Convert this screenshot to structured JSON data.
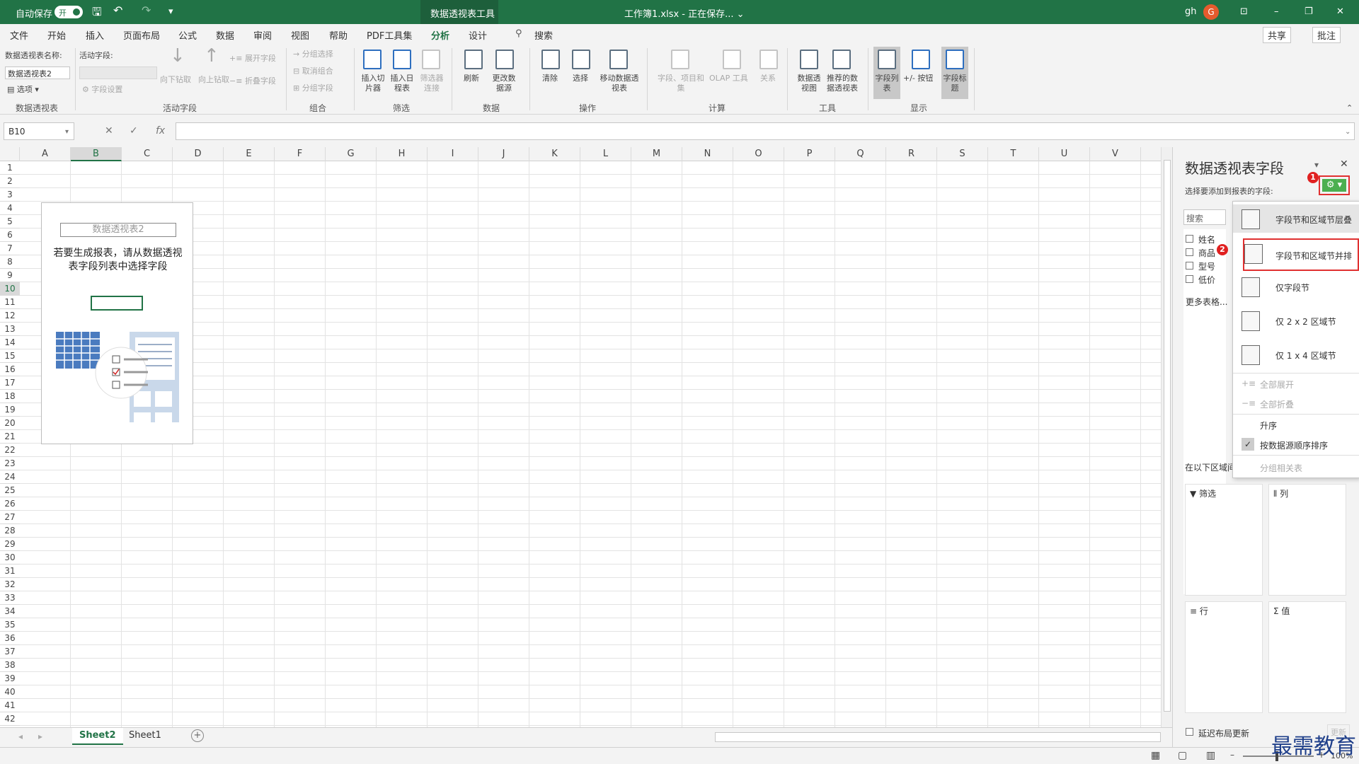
{
  "title_bar": {
    "autosave_label": "自动保存",
    "autosave_state": "开",
    "context_tool": "数据透视表工具",
    "file_title": "工作簿1.xlsx - 正在保存... ⌄",
    "user": "gh",
    "avatar": "G",
    "minimize": "–",
    "restore": "❐",
    "close": "✕"
  },
  "tabs": [
    "文件",
    "开始",
    "插入",
    "页面布局",
    "公式",
    "数据",
    "审阅",
    "视图",
    "帮助",
    "PDF工具集",
    "分析",
    "设计"
  ],
  "active_tab": "分析",
  "search_label": "搜索",
  "share_label": "共享",
  "comment_label": "批注",
  "ribbon": {
    "pt_name_label": "数据透视表名称:",
    "pt_name_value": "数据透视表2",
    "options_label": "选项",
    "group_pivot": "数据透视表",
    "active_field_label": "活动字段:",
    "field_settings": "字段设置",
    "drill_down": "向下钻取",
    "drill_up": "向上钻取",
    "expand_field": "展开字段",
    "collapse_field": "折叠字段",
    "group_active_field": "活动字段",
    "group_selection": "分组选择",
    "ungroup": "取消组合",
    "group_field": "分组字段",
    "group_group": "组合",
    "insert_slicer": "插入切片器",
    "insert_timeline": "插入日程表",
    "filter_connections": "筛选器连接",
    "group_filter": "筛选",
    "refresh": "刷新",
    "change_source": "更改数据源",
    "group_data": "数据",
    "clear": "清除",
    "select": "选择",
    "move_pivot": "移动数据透视表",
    "group_actions": "操作",
    "fields_items": "字段、项目和集",
    "olap_tools": "OLAP 工具",
    "relationships": "关系",
    "group_calc": "计算",
    "pivot_chart": "数据透视图",
    "recommended": "推荐的数据透视表",
    "group_tools": "工具",
    "field_list": "字段列表",
    "buttons": "+/- 按钮",
    "field_headers": "字段标题",
    "group_show": "显示"
  },
  "formula_bar": {
    "name_box": "B10",
    "cancel": "✕",
    "enter": "✓",
    "fx": "fx",
    "formula": ""
  },
  "columns": [
    "A",
    "B",
    "C",
    "D",
    "E",
    "F",
    "G",
    "H",
    "I",
    "J",
    "K",
    "L",
    "M",
    "N",
    "O",
    "P",
    "Q",
    "R",
    "S",
    "T",
    "U",
    "V"
  ],
  "selected_column": "B",
  "selected_row": 10,
  "row_count": 42,
  "pivot_placeholder": {
    "title": "数据透视表2",
    "line1": "若要生成报表，请从数据透视",
    "line2": "表字段列表中选择字段"
  },
  "sheet_tabs": [
    "Sheet2",
    "Sheet1"
  ],
  "active_sheet": "Sheet2",
  "add_sheet": "+",
  "status": {
    "zoom": "100%"
  },
  "panel": {
    "title": "数据透视表字段",
    "subtitle": "选择要添加到报表的字段:",
    "search_placeholder": "搜索",
    "fields": [
      "姓名",
      "商品",
      "型号",
      "低价"
    ],
    "more_tables": "更多表格...",
    "areas_label": "在以下区域间",
    "filter_label": "筛选",
    "columns_label": "列",
    "rows_label": "行",
    "values_label": "值",
    "defer_label": "延迟布局更新",
    "update_label": "更新",
    "badge1": "1",
    "badge2": "2"
  },
  "menu": {
    "stacked": "字段节和区域节层叠",
    "side_by_side": "字段节和区域节并排",
    "fields_only": "仅字段节",
    "areas_2x2": "仅 2 x 2 区域节",
    "areas_1x4": "仅 1 x 4 区域节",
    "expand_all": "全部展开",
    "collapse_all": "全部折叠",
    "sort_az": "升序",
    "sort_source": "按数据源顺序排序",
    "group_relations": "分组相关表"
  },
  "watermark": "最需教育",
  "colors": {
    "excel_green": "#217346",
    "highlight_red": "#e03030"
  }
}
